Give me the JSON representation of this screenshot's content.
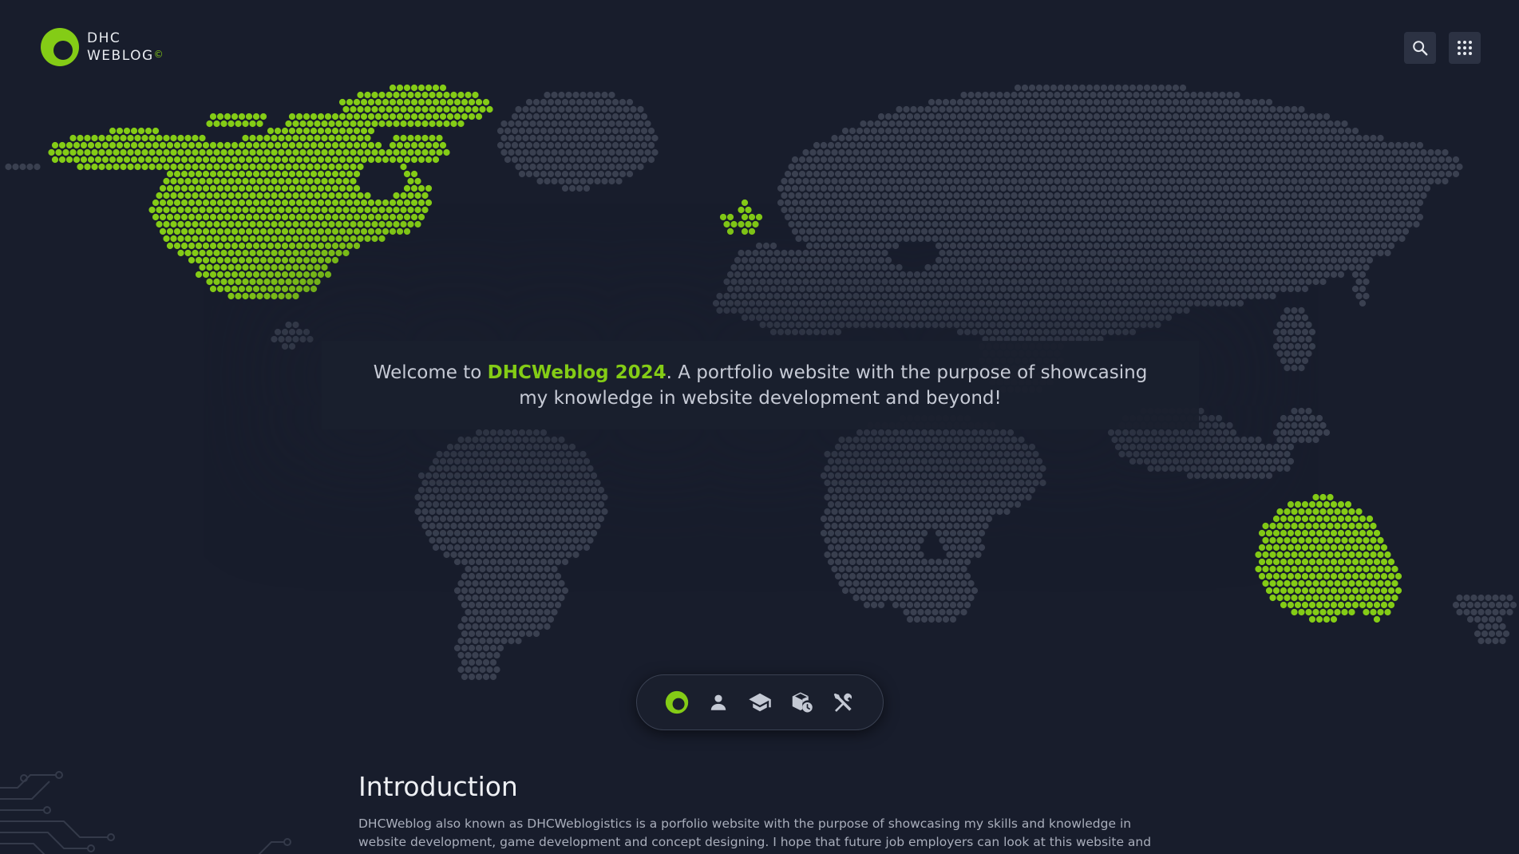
{
  "header": {
    "logo_line1": "DHC",
    "logo_line2": "WEBLOG",
    "logo_mark": "©",
    "search_icon": "search-icon",
    "apps_icon": "apps-grid-icon"
  },
  "welcome": {
    "prefix": "Welcome to ",
    "highlight": "DHCWeblog 2024",
    "suffix": ". A portfolio website with the purpose of showcasing my knowledge in website development and beyond!"
  },
  "nav": {
    "items": [
      {
        "icon": "home-logo-icon",
        "active": true
      },
      {
        "icon": "person-icon",
        "active": false
      },
      {
        "icon": "graduation-cap-icon",
        "active": false
      },
      {
        "icon": "package-clock-icon",
        "active": false
      },
      {
        "icon": "tools-icon",
        "active": false
      }
    ]
  },
  "intro": {
    "title": "Introduction",
    "body": "DHCWeblog also known as DHCWeblogistics is a porfolio website with the purpose of showcasing my skills and knowledge in website development, game development and concept designing. I hope that future job employers can look at this website and learn about my"
  },
  "colors": {
    "background": "#181d2c",
    "accent": "#84cc16",
    "map_dot": "#3a4050",
    "text": "#c6cad5"
  }
}
